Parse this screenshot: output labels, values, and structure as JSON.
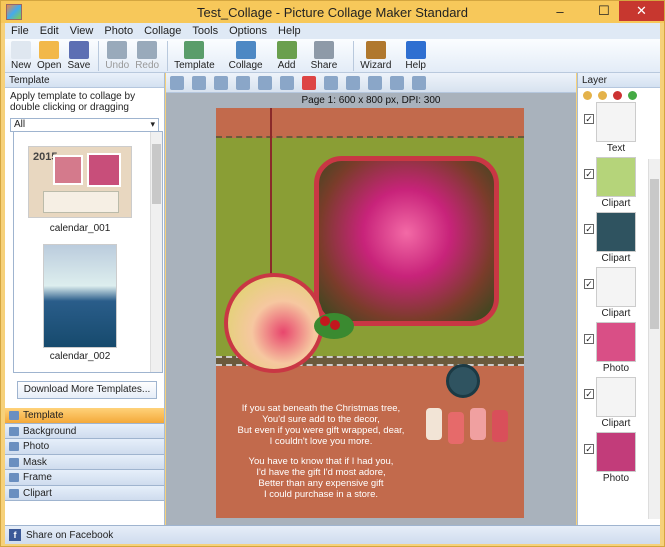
{
  "window": {
    "title": "Test_Collage - Picture Collage Maker Standard"
  },
  "menu": [
    "File",
    "Edit",
    "View",
    "Photo",
    "Collage",
    "Tools",
    "Options",
    "Help"
  ],
  "toolbar": [
    {
      "label": "New",
      "color": "#dfe7f0"
    },
    {
      "label": "Open",
      "color": "#f2b84a"
    },
    {
      "label": "Save",
      "color": "#5d6fb3"
    },
    {
      "label": "Undo",
      "color": "#9ab",
      "disabled": true
    },
    {
      "label": "Redo",
      "color": "#9ab",
      "disabled": true
    },
    {
      "label": "Template",
      "color": "#5a9d6a"
    },
    {
      "label": "Collage",
      "color": "#4d88c4"
    },
    {
      "label": "Add",
      "color": "#6a9f4e"
    },
    {
      "label": "Share",
      "color": "#8e9aa8"
    },
    {
      "label": "Wizard",
      "color": "#b0782e"
    },
    {
      "label": "Help",
      "color": "#2f6fd1"
    }
  ],
  "left": {
    "header": "Template",
    "hint": "Apply template to collage by double clicking or dragging",
    "filter": "All",
    "templates": [
      "calendar_001",
      "calendar_002"
    ],
    "thumb_year": "2015",
    "download_label": "Download More Templates...",
    "nav": [
      "Template",
      "Background",
      "Photo",
      "Mask",
      "Frame",
      "Clipart"
    ]
  },
  "canvas": {
    "page_info": "Page 1: 600 x 800 px, DPI: 300",
    "poem1": [
      "If you sat beneath the Christmas tree,",
      "You'd sure add to the decor,",
      "But even if you were gift wrapped, dear,",
      "I couldn't love you more."
    ],
    "poem2": [
      "You have to know that if I had you,",
      "I'd have the gift I'd most adore,",
      "Better than any expensive gift",
      "I could purchase in a store."
    ]
  },
  "right": {
    "header": "Layer",
    "layers": [
      {
        "label": "Text",
        "color": "#f4f4f4"
      },
      {
        "label": "Clipart",
        "color": "#b5d47a"
      },
      {
        "label": "Clipart",
        "color": "#2f5360"
      },
      {
        "label": "Clipart",
        "color": "#f4f4f4"
      },
      {
        "label": "Photo",
        "color": "#d94f86"
      },
      {
        "label": "Clipart",
        "color": "#f4f4f4"
      },
      {
        "label": "Photo",
        "color": "#c23c7a"
      }
    ]
  },
  "status": {
    "share": "Share on Facebook"
  }
}
